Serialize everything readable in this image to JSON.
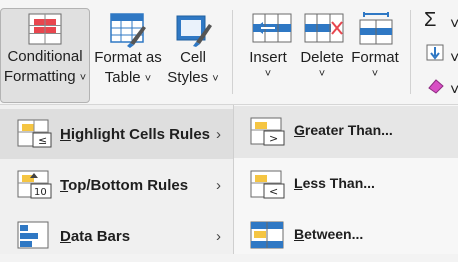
{
  "ribbon": {
    "conditional_formatting": {
      "line1": "Conditional",
      "line2": "Formatting",
      "chevron": "˅"
    },
    "format_as_table": {
      "line1": "Format as",
      "line2": "Table",
      "chevron": "˅"
    },
    "cell_styles": {
      "line1": "Cell",
      "line2": "Styles",
      "chevron": "˅"
    },
    "insert": {
      "label": "Insert",
      "chevron": "˅"
    },
    "delete": {
      "label": "Delete",
      "chevron": "˅"
    },
    "format": {
      "label": "Format",
      "chevron": "˅"
    },
    "sum_chevron": "˅",
    "fill_chevron": "˅",
    "clear_chevron": "˅"
  },
  "menu": {
    "items": [
      {
        "accel": "H",
        "rest": "ighlight Cells Rules",
        "arrow": "›"
      },
      {
        "accel": "T",
        "rest": "op/Bottom Rules",
        "arrow": "›"
      },
      {
        "accel": "D",
        "rest": "ata Bars",
        "arrow": "›"
      }
    ]
  },
  "submenu": {
    "items": [
      {
        "accel": "G",
        "rest": "reater Than..."
      },
      {
        "accel": "L",
        "rest": "ess Than..."
      },
      {
        "accel": "B",
        "rest": "etween..."
      }
    ]
  },
  "colors": {
    "accent_red": "#e8464e",
    "accent_blue": "#2f78c4",
    "accent_yellow": "#f5c542"
  }
}
